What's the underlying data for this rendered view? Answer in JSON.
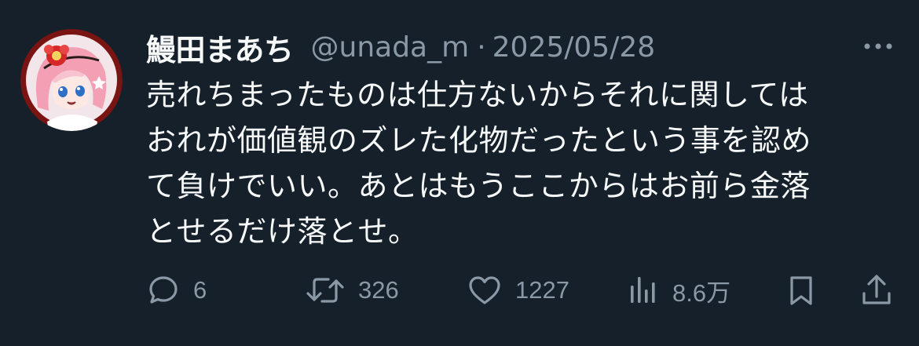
{
  "tweet": {
    "display_name": "鰻田まあち",
    "handle": "@unada_m",
    "separator": "·",
    "date": "2025/05/28",
    "text": "売れちまったものは仕方ないからそれに関しては\nおれが価値観のズレた化物だったという事を認め\nて負けでいい。あとはもうここからはお前ら金落\nとせるだけ落とせ。"
  },
  "actions": {
    "reply": {
      "icon": "reply-icon",
      "count": "6"
    },
    "retweet": {
      "icon": "retweet-icon",
      "count": "326"
    },
    "like": {
      "icon": "heart-icon",
      "count": "1227"
    },
    "views": {
      "icon": "views-icon",
      "count": "8.6万"
    },
    "bookmark": {
      "icon": "bookmark-icon"
    },
    "share": {
      "icon": "share-icon"
    }
  },
  "colors": {
    "background": "#15202b",
    "text_primary": "#f7f9f9",
    "text_secondary": "#8b98a5"
  }
}
